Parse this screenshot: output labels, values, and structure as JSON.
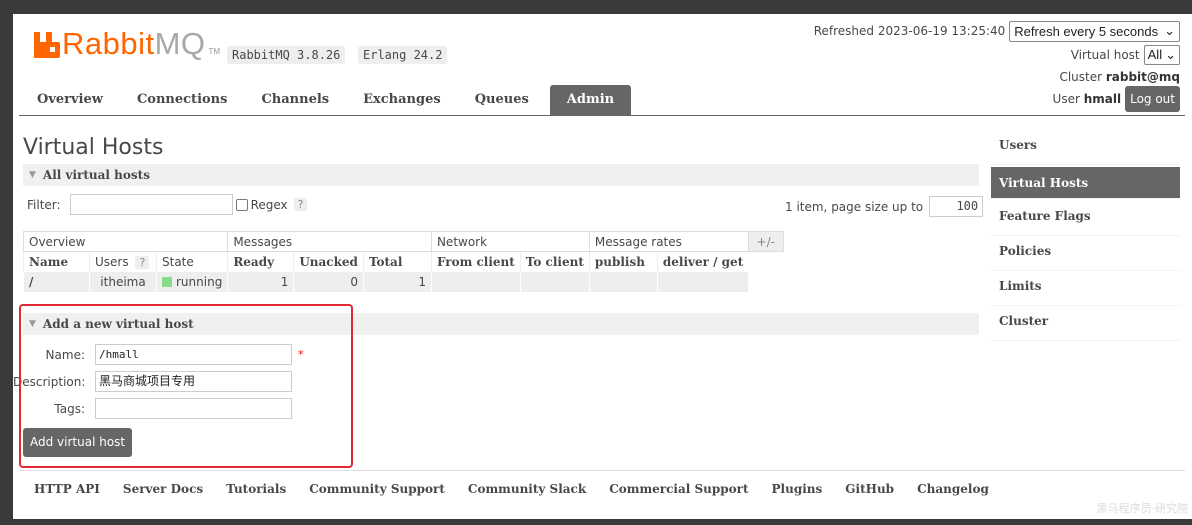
{
  "brand": {
    "rabbit": "Rabbit",
    "mq": "MQ",
    "tm": "TM",
    "accent_color": "#ff6600"
  },
  "versions": {
    "rabbitmq": "RabbitMQ 3.8.26",
    "erlang": "Erlang 24.2"
  },
  "header": {
    "refreshed": "Refreshed 2023-06-19 13:25:40",
    "refresh_select": "Refresh every 5 seconds",
    "vhost_label": "Virtual host",
    "vhost_select": "All",
    "cluster_label": "Cluster",
    "cluster_value": "rabbit@mq",
    "user_label": "User",
    "user_value": "hmall",
    "logout": "Log out"
  },
  "nav": {
    "tabs": [
      "Overview",
      "Connections",
      "Channels",
      "Exchanges",
      "Queues",
      "Admin"
    ],
    "active": "Admin"
  },
  "main": {
    "title": "Virtual Hosts",
    "all_section": "All virtual hosts",
    "filter_label": "Filter:",
    "filter_value": "",
    "regex_label": "Regex",
    "help": "?",
    "paging_text": "1 item, page size up to",
    "page_size": "100"
  },
  "table": {
    "groups": [
      "Overview",
      "Messages",
      "Network",
      "Message rates"
    ],
    "plusminus": "+/-",
    "columns": [
      "Name",
      "Users",
      "State",
      "Ready",
      "Unacked",
      "Total",
      "From client",
      "To client",
      "publish",
      "deliver / get"
    ],
    "rows": [
      {
        "name": "/",
        "users": "itheima",
        "state": "running",
        "ready": "1",
        "unacked": "0",
        "total": "1",
        "from_client": "",
        "to_client": "",
        "publish": "",
        "deliver_get": ""
      }
    ]
  },
  "add_vhost": {
    "section": "Add a new virtual host",
    "name_label": "Name:",
    "name_value": "/hmall",
    "required": "*",
    "description_label": "Description:",
    "description_value": "黑马商城项目专用",
    "tags_label": "Tags:",
    "tags_value": "",
    "button": "Add virtual host"
  },
  "sidebar": {
    "items": [
      "Users",
      "Virtual Hosts",
      "Feature Flags",
      "Policies",
      "Limits",
      "Cluster"
    ],
    "active": "Virtual Hosts"
  },
  "footer": {
    "links": [
      "HTTP API",
      "Server Docs",
      "Tutorials",
      "Community Support",
      "Community Slack",
      "Commercial Support",
      "Plugins",
      "GitHub",
      "Changelog"
    ]
  },
  "watermark": "黑马程序员·研究院"
}
